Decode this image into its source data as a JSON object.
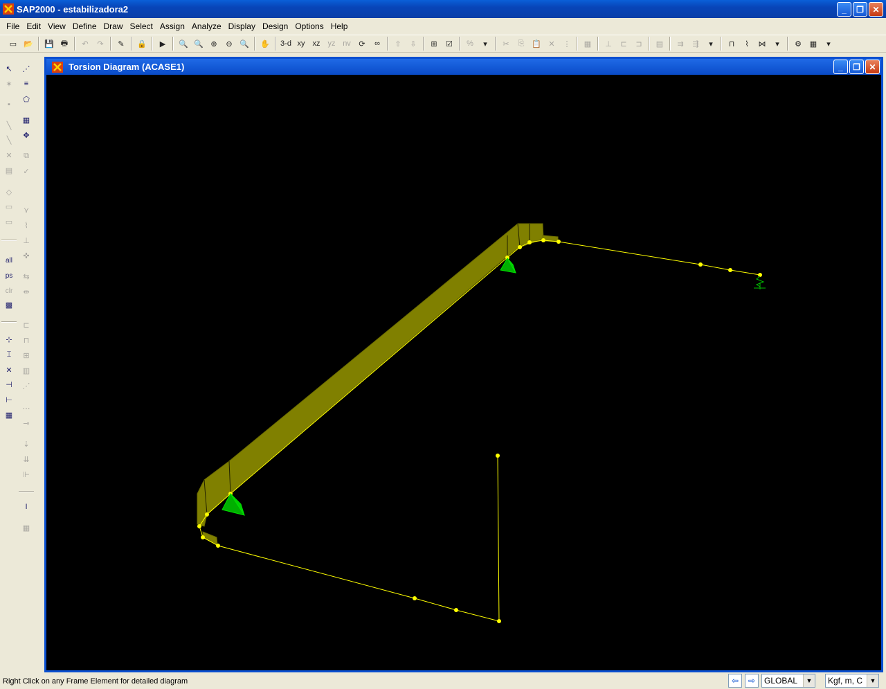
{
  "app": {
    "title": "SAP2000 - estabilizadora2"
  },
  "window_buttons": {
    "minimize": "_",
    "restore": "❐",
    "close": "✕"
  },
  "menu": [
    "File",
    "Edit",
    "View",
    "Define",
    "Draw",
    "Select",
    "Assign",
    "Analyze",
    "Display",
    "Design",
    "Options",
    "Help"
  ],
  "toolbar": {
    "view_3d": "3-d",
    "view_xy": "xy",
    "view_xz": "xz",
    "view_yz": "yz",
    "view_nv": "nv"
  },
  "left_toolbar": {
    "select_all": "all",
    "select_previous": "ps",
    "clear_selection": "clr"
  },
  "child_window": {
    "title": "Torsion Diagram  (ACASE1)"
  },
  "status": {
    "message": "Right Click on any Frame Element for detailed diagram",
    "coord_system": "GLOBAL",
    "units": "Kgf, m, C"
  },
  "colors": {
    "canvas_bg": "#000000",
    "frame_line": "#ffff00",
    "diagram_fill": "#808000",
    "support": "#00c000"
  }
}
